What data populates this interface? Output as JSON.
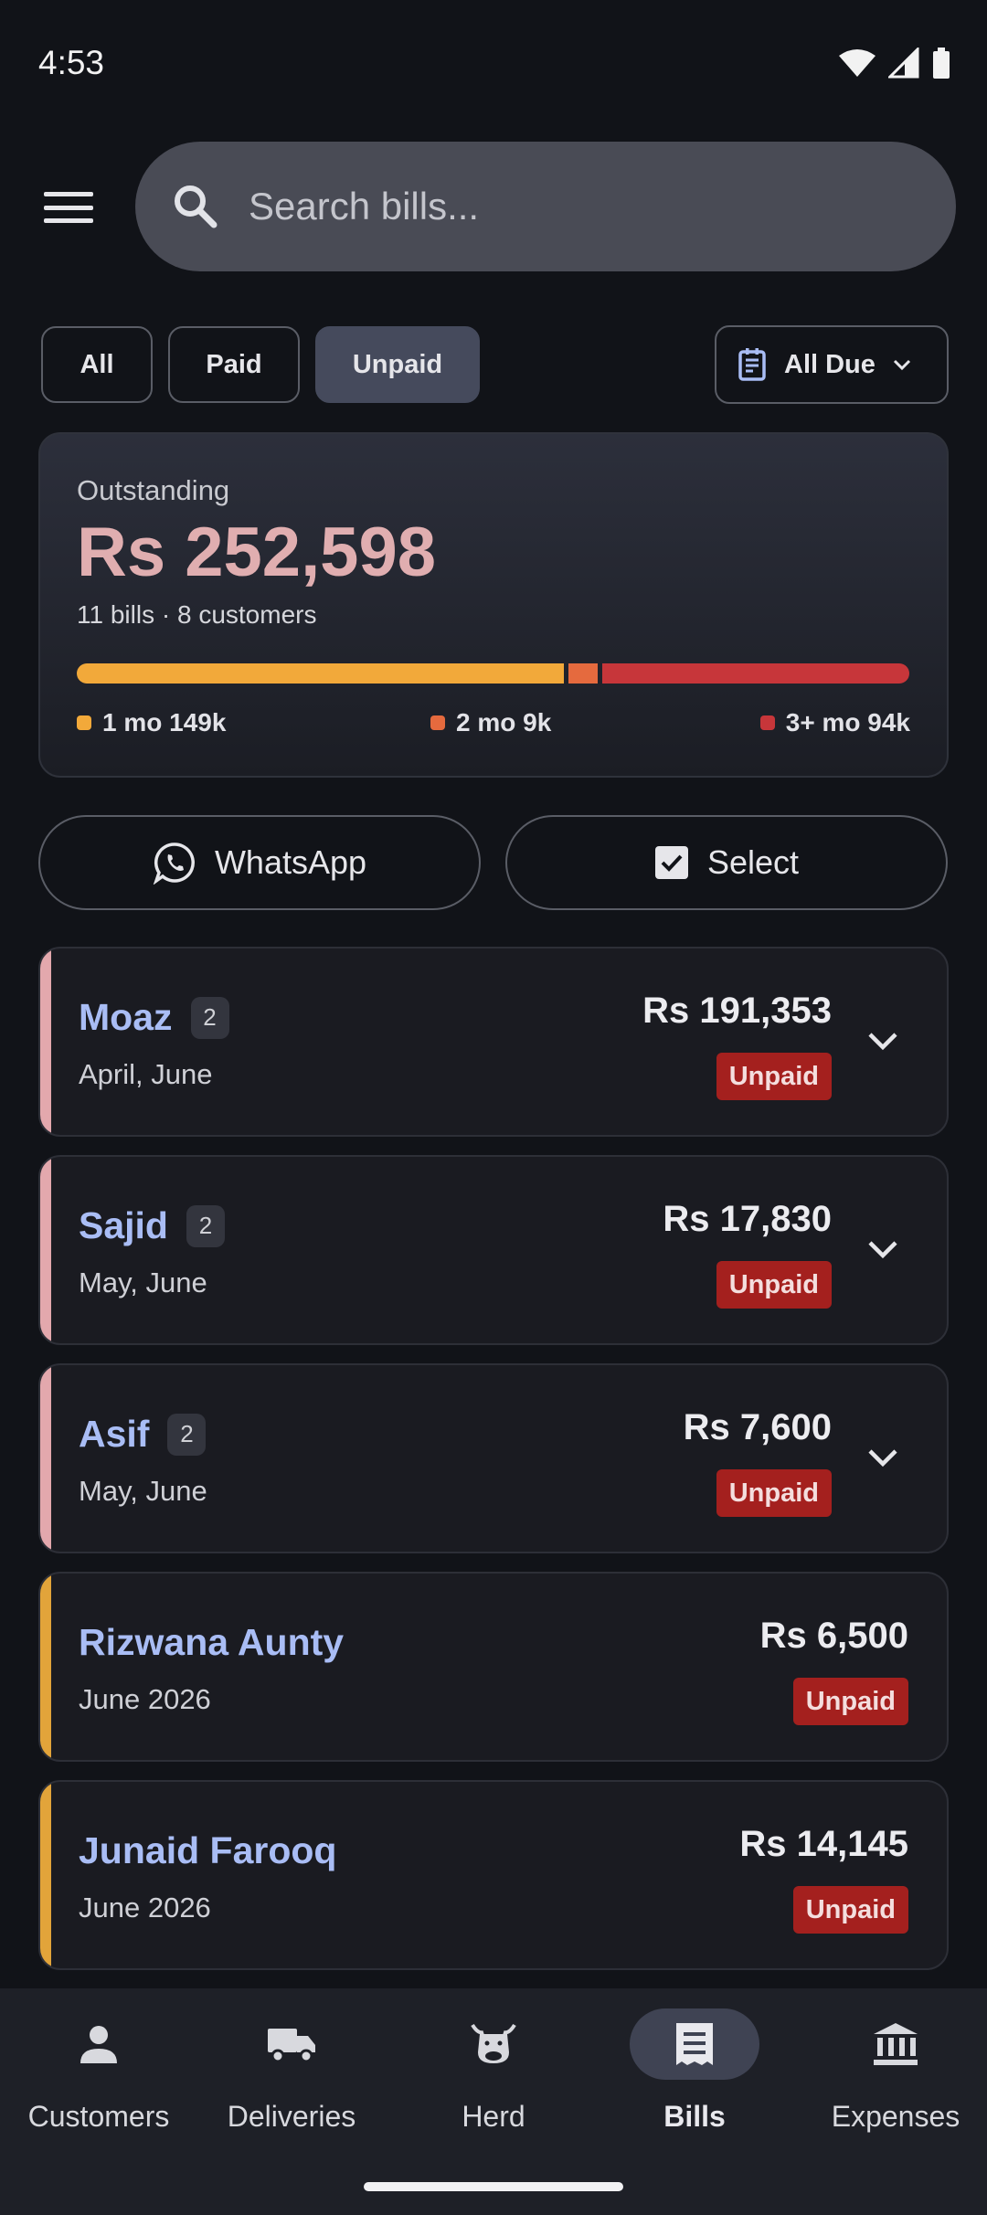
{
  "status_bar": {
    "time": "4:53"
  },
  "search": {
    "placeholder": "Search bills..."
  },
  "filters": {
    "all": "All",
    "paid": "Paid",
    "unpaid": "Unpaid",
    "active": "Unpaid"
  },
  "due_filter": {
    "selected": "All Due"
  },
  "summary": {
    "label": "Outstanding",
    "amount": "Rs 252,598",
    "subtitle": "11 bills · 8 customers",
    "aging": [
      {
        "label": "1 mo 149k",
        "value": 149,
        "color": "#f2a93a"
      },
      {
        "label": "2 mo 9k",
        "value": 9,
        "color": "#e56a3e"
      },
      {
        "label": "3+ mo 94k",
        "value": 94,
        "color": "#c7363a"
      }
    ]
  },
  "actions": {
    "whatsapp": "WhatsApp",
    "select": "Select"
  },
  "bills": [
    {
      "name": "Moaz",
      "count": "2",
      "period": "April, June",
      "amount": "Rs 191,353",
      "status": "Unpaid",
      "stripe": "#e3a8ad",
      "expandable": true
    },
    {
      "name": "Sajid",
      "count": "2",
      "period": "May, June",
      "amount": "Rs 17,830",
      "status": "Unpaid",
      "stripe": "#e3a8ad",
      "expandable": true
    },
    {
      "name": "Asif",
      "count": "2",
      "period": "May, June",
      "amount": "Rs 7,600",
      "status": "Unpaid",
      "stripe": "#e3a8ad",
      "expandable": true
    },
    {
      "name": "Rizwana Aunty",
      "period": "June 2026",
      "amount": "Rs 6,500",
      "status": "Unpaid",
      "stripe": "#e2a43a",
      "expandable": false
    },
    {
      "name": "Junaid Farooq",
      "period": "June 2026",
      "amount": "Rs 14,145",
      "status": "Unpaid",
      "stripe": "#e2a43a",
      "expandable": false
    }
  ],
  "nav": {
    "active": "Bills",
    "items": [
      {
        "label": "Customers",
        "icon": "person-icon"
      },
      {
        "label": "Deliveries",
        "icon": "truck-icon"
      },
      {
        "label": "Herd",
        "icon": "cow-icon"
      },
      {
        "label": "Bills",
        "icon": "receipt-icon"
      },
      {
        "label": "Expenses",
        "icon": "bank-icon"
      }
    ]
  }
}
